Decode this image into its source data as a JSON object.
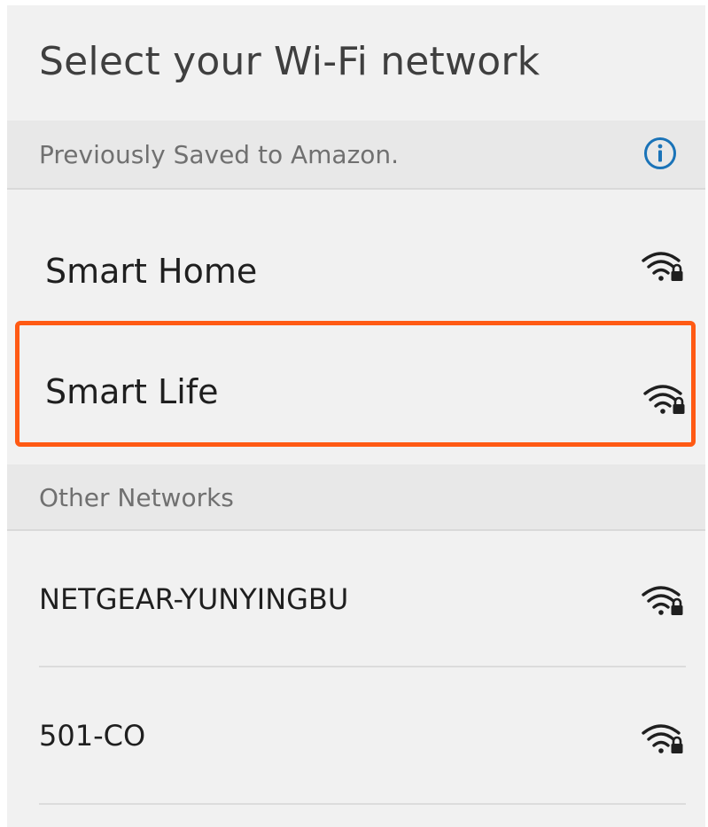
{
  "header": {
    "title": "Select your Wi-Fi network"
  },
  "saved_section": {
    "label": "Previously Saved to Amazon.",
    "info_icon": "info-icon"
  },
  "saved_networks": [
    {
      "name": "Smart Home",
      "icon": "wifi-lock-icon",
      "highlighted": false
    },
    {
      "name": "Smart Life",
      "icon": "wifi-lock-icon",
      "highlighted": true
    }
  ],
  "other_section": {
    "label": "Other Networks"
  },
  "other_networks": [
    {
      "name": "NETGEAR-YUNYINGBU",
      "icon": "wifi-lock-icon"
    },
    {
      "name": "501-CO",
      "icon": "wifi-lock-icon"
    }
  ],
  "colors": {
    "background": "#f1f1f1",
    "section_header": "#e8e8e8",
    "highlight": "#ff5a14",
    "info_blue": "#1a73b8"
  }
}
